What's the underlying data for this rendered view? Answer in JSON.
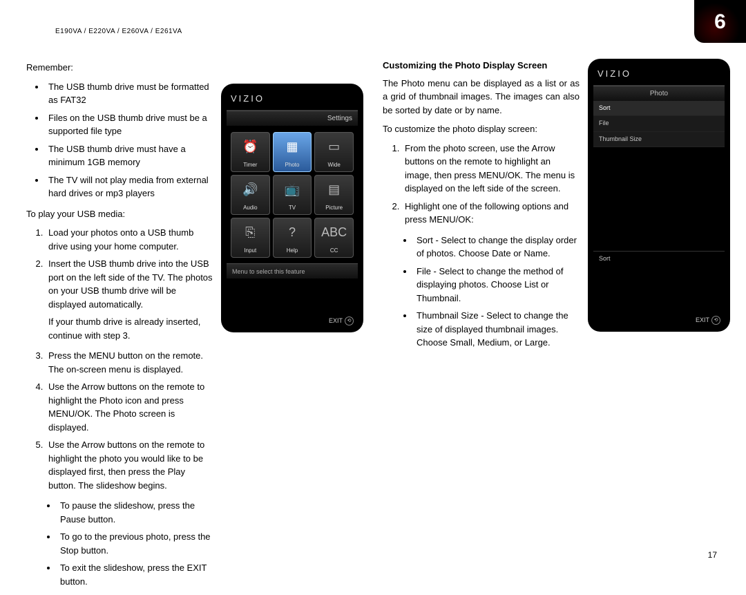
{
  "header_model": "E190VA / E220VA / E260VA / E261VA",
  "chapter_number": "6",
  "page_number": "17",
  "left": {
    "remember_label": "Remember:",
    "remember_bullets": [
      "The USB thumb drive must be formatted as FAT32",
      "Files on the USB thumb drive must be a supported file type",
      "The USB thumb drive must have a minimum 1GB memory",
      "The TV will not play media from external hard drives or mp3 players"
    ],
    "play_intro": "To play your USB media:",
    "steps": [
      "Load your photos onto a USB thumb drive using your home computer.",
      "Insert the USB thumb drive into the USB port on the left side of the TV. The photos on your USB thumb drive will be displayed automatically.",
      "Press the MENU button on the remote. The on-screen menu is displayed.",
      "Use the Arrow buttons on the remote to highlight the Photo icon and press MENU/OK. The Photo screen is displayed.",
      "Use the Arrow buttons on the remote to highlight the photo you would like to be displayed first, then press the Play button. The slideshow begins."
    ],
    "step2_extra": "If your thumb drive is already inserted, continue with step 3.",
    "sub_bullets": [
      "To pause the slideshow, press the Pause button.",
      "To go to the previous photo, press the Stop button.",
      "To exit the slideshow, press the EXIT button."
    ]
  },
  "right": {
    "section_title": "Customizing the Photo Display Screen",
    "intro": "The Photo menu can be displayed as a list or as a grid of thumbnail images. The images can also be sorted by date or by name.",
    "customize_intro": "To customize the photo display screen:",
    "steps": [
      "From the photo screen, use the Arrow buttons on the remote to highlight an image, then press MENU/OK. The menu is displayed on the left side of the screen.",
      "Highlight one of the following options and press MENU/OK:"
    ],
    "options": [
      "Sort - Select to change the display order of photos. Choose Date or Name.",
      "File - Select to change the method of displaying photos. Choose List or Thumbnail.",
      "Thumbnail Size - Select to change the size of displayed thumbnail images. Choose Small, Medium, or Large."
    ]
  },
  "device1": {
    "brand": "VIZIO",
    "title": "Settings",
    "tiles": [
      {
        "label": "Timer",
        "icon": "⏰"
      },
      {
        "label": "Photo",
        "icon": "▦",
        "selected": true
      },
      {
        "label": "Wide",
        "icon": "▭"
      },
      {
        "label": "Audio",
        "icon": "🔊"
      },
      {
        "label": "TV",
        "icon": "📺"
      },
      {
        "label": "Picture",
        "icon": "▤"
      },
      {
        "label": "Input",
        "icon": "⎘"
      },
      {
        "label": "Help",
        "icon": "?"
      },
      {
        "label": "CC",
        "icon": "ABC"
      }
    ],
    "hint": "Menu to select this feature",
    "exit": "EXIT"
  },
  "device2": {
    "brand": "VIZIO",
    "title": "Photo",
    "rows": [
      "Sort",
      "File",
      "Thumbnail Size"
    ],
    "footer": "Sort",
    "exit": "EXIT"
  }
}
